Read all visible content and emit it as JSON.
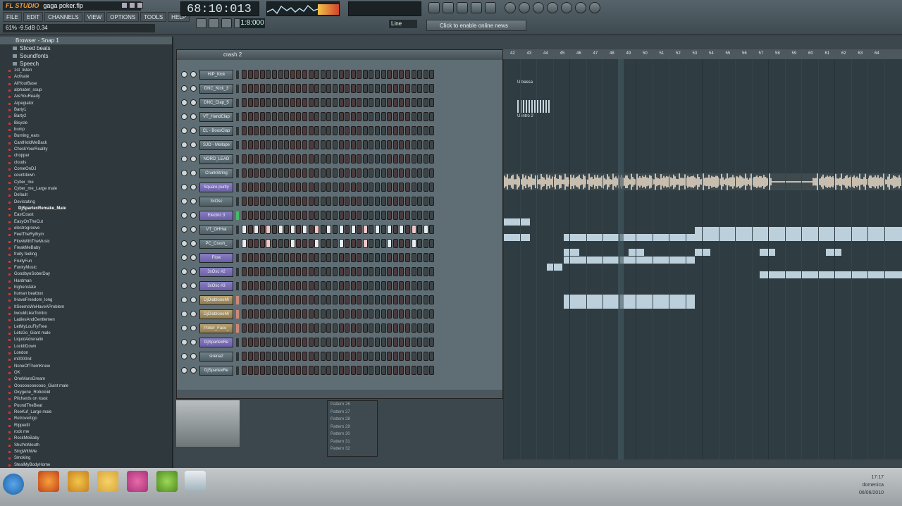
{
  "app": {
    "logo": "FL STUDIO",
    "project": "gaga poker.flp",
    "menu": [
      "FILE",
      "EDIT",
      "CHANNELS",
      "VIEW",
      "OPTIONS",
      "TOOLS",
      "HELP"
    ],
    "hint": "61%  -9.5dB  0.34",
    "time": "68:10:013",
    "tempo": "1:8:000",
    "snap": "Line",
    "news": "Click to enable online news"
  },
  "browser": {
    "title": "Browser - Snap 1",
    "folders": [
      "Sliced beats",
      "Soundfonts",
      "Speech"
    ],
    "items": [
      "1st_listen",
      "Activate",
      "AllYourBase",
      "alphabet_soup",
      "AreYouReady",
      "Arpegiator",
      "Barty1",
      "Barty2",
      "Bicycle",
      "bump",
      "Burning_ears",
      "CantHoldMeBack",
      "CheckYourReality",
      "chopper",
      "clouds",
      "ComeOnDJ",
      "countdown",
      "Cyber_me",
      "Cyber_me_Large male",
      "Default",
      "Devistating",
      "DjSpartexRemake_Male",
      "EastCoast",
      "EasyOnTheCut",
      "electrogroove",
      "FeelTheRythym",
      "FlowWithTheMusic",
      "FreakMeBaby",
      "fruity feeling",
      "FruityFun",
      "FunkyMusic",
      "GoodbyeSoberDay",
      "Hardman",
      "highenstate",
      "human beatbox",
      "IHaveFreedom_long",
      "ItSeemsWeHaveAProblem",
      "IwouldLikeToIntro",
      "LadiesAndGentlemen",
      "LetMyLouFlyFree",
      "LetsGo_Giant male",
      "LiquidAdrenalin",
      "LockItDown",
      "London",
      "m0000nit",
      "NoneOfThemKnew",
      "OK",
      "OneMansDream",
      "Ooooooooooooo_Giant male",
      "Oxygene_Robotoid",
      "Pilchards on toast",
      "PoundTheBeat",
      "ReeKuf_Large male",
      "Retrovertigo",
      "RippedIt",
      "rock me",
      "RockMeBaby",
      "ShutYoMouth",
      "SingWithMe",
      "Smoking",
      "StealMyBodyHome"
    ],
    "selected": "DjSpartexRemake_Male"
  },
  "stepseq": {
    "pattern": "crash 2",
    "channels": [
      {
        "name": "HIP_Kick",
        "style": "normal",
        "pattern": "none"
      },
      {
        "name": "DNC_Kick_3",
        "style": "normal",
        "pattern": "none"
      },
      {
        "name": "DNC_Clap_5",
        "style": "normal",
        "pattern": "none"
      },
      {
        "name": "VT_HandClap",
        "style": "normal",
        "pattern": "none"
      },
      {
        "name": "CL - BoosClap",
        "style": "normal",
        "pattern": "none"
      },
      {
        "name": "SJO - Mellope",
        "style": "normal",
        "pattern": "none"
      },
      {
        "name": "NORD_LEAD",
        "style": "normal",
        "pattern": "none"
      },
      {
        "name": "CrunkString",
        "style": "normal",
        "pattern": "none"
      },
      {
        "name": "Square purity",
        "style": "purple",
        "pattern": "none"
      },
      {
        "name": "3xOsc",
        "style": "normal",
        "pattern": "none"
      },
      {
        "name": "Electric 3",
        "style": "purple",
        "pattern": "none"
      },
      {
        "name": "VT_OHHat",
        "style": "normal",
        "pattern": "hat"
      },
      {
        "name": "PC_Crash_",
        "style": "normal",
        "pattern": "crash"
      },
      {
        "name": "Flow",
        "style": "purple",
        "pattern": "none"
      },
      {
        "name": "3xOsc #2",
        "style": "purple",
        "pattern": "none"
      },
      {
        "name": "3xOsc #3",
        "style": "purple",
        "pattern": "none"
      },
      {
        "name": "DjDiabloooMi",
        "style": "orange",
        "pattern": "none"
      },
      {
        "name": "DjDiabloooMi",
        "style": "orange",
        "pattern": "none"
      },
      {
        "name": "Poker_Face_",
        "style": "orange",
        "pattern": "none"
      },
      {
        "name": "DjSpartexRe",
        "style": "purple",
        "pattern": "none"
      },
      {
        "name": "sirena2",
        "style": "normal",
        "pattern": "none"
      },
      {
        "name": "DjSpartexRe",
        "style": "normal",
        "pattern": "none"
      }
    ]
  },
  "playlist": {
    "ruler": [
      "42",
      "43",
      "44",
      "45",
      "46",
      "47",
      "48",
      "49",
      "50",
      "51",
      "52",
      "53",
      "54",
      "55",
      "56",
      "57",
      "58",
      "59",
      "60",
      "61",
      "62",
      "63",
      "64"
    ],
    "clip_labels": [
      "U bassa",
      "U intro 2"
    ],
    "patterns": [
      "Pattern 26",
      "Pattern 27",
      "Pattern 28",
      "Pattern 29",
      "Pattern 30",
      "Pattern 31",
      "Pattern 32"
    ]
  },
  "taskbar": {
    "time": "17:17",
    "day": "domenica",
    "date": "06/06/2010"
  }
}
